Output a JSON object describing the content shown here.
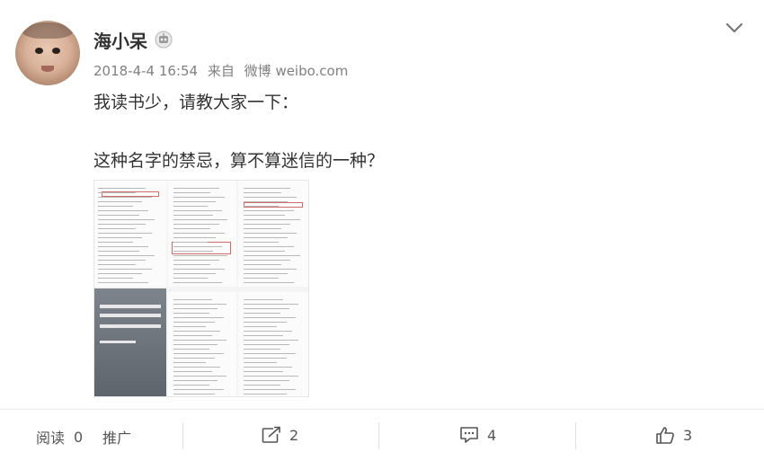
{
  "post": {
    "username": "海小呆",
    "time": "2018-4-4 16:54",
    "source_prefix": "来自",
    "source": "微博 weibo.com",
    "lines": [
      "我读书少，请教大家一下：",
      "这种名字的禁忌，算不算迷信的一种？"
    ]
  },
  "icons": {
    "badge": "robot-badge-icon",
    "more": "chevron-down-icon",
    "forward": "share-icon",
    "comment": "comment-icon",
    "like": "thumbs-up-icon"
  },
  "actions": {
    "read_label": "阅读",
    "read_count": "0",
    "promote_label": "推广",
    "forward_count": "2",
    "comment_count": "4",
    "like_count": "3"
  },
  "colors": {
    "text": "#333333",
    "meta": "#808080",
    "divider": "#ececec"
  }
}
